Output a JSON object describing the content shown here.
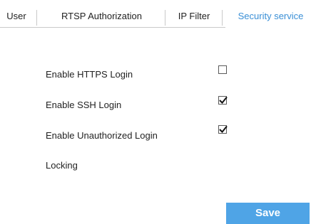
{
  "tabs": [
    {
      "label": "User",
      "active": false
    },
    {
      "label": "RTSP Authorization",
      "active": false
    },
    {
      "label": "IP Filter",
      "active": false
    },
    {
      "label": "Security service",
      "active": true
    }
  ],
  "settings": [
    {
      "label": "Enable HTTPS Login",
      "checked": false
    },
    {
      "label": "Enable SSH Login",
      "checked": true
    },
    {
      "label": "Enable Unauthorized Login",
      "checked": true
    },
    {
      "label": "Locking"
    }
  ],
  "save_label": "Save",
  "colors": {
    "accent": "#3a8fd6",
    "save_button": "#4fa4e6",
    "border": "#c9c9c9",
    "text": "#222222"
  }
}
